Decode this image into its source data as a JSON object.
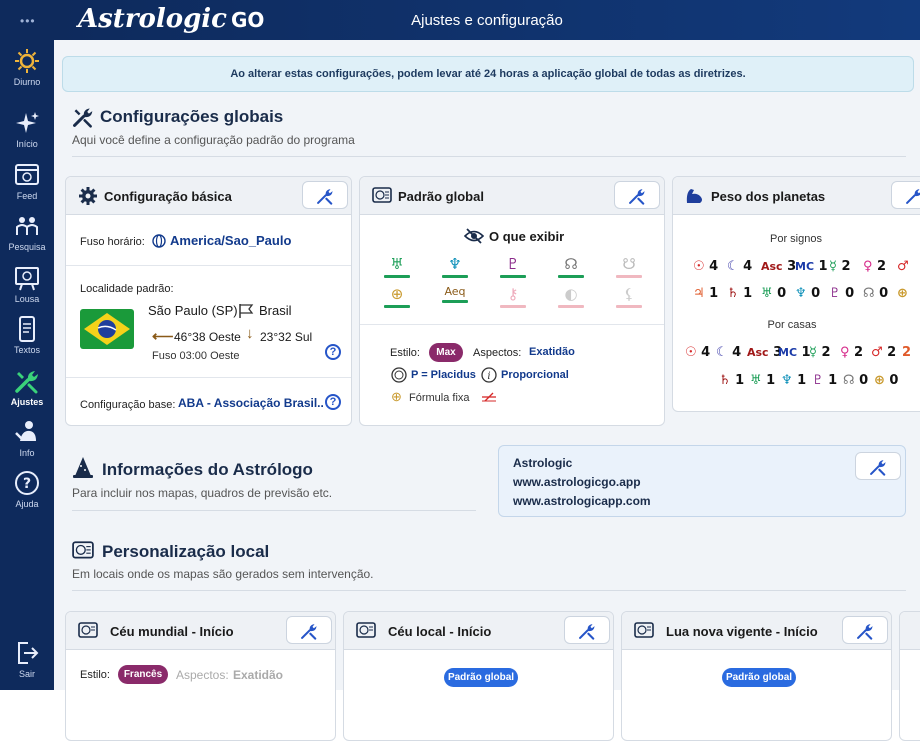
{
  "app": {
    "brand": "Astrologic",
    "brand_suffix": "GO",
    "dots": "•••",
    "page_title": "Ajustes e configuração"
  },
  "sidebar": {
    "items": [
      {
        "label": "Diurno",
        "icon": "sun-icon"
      },
      {
        "label": "Início",
        "icon": "sparkle-icon"
      },
      {
        "label": "Feed",
        "icon": "feed-icon"
      },
      {
        "label": "Pesquisa",
        "icon": "people-icon"
      },
      {
        "label": "Lousa",
        "icon": "board-icon"
      },
      {
        "label": "Textos",
        "icon": "phone-text-icon"
      },
      {
        "label": "Ajustes",
        "icon": "tools-icon",
        "active": true
      },
      {
        "label": "Info",
        "icon": "user-info-icon"
      },
      {
        "label": "Ajuda",
        "icon": "help-icon"
      },
      {
        "label": "Sair",
        "icon": "exit-icon"
      }
    ]
  },
  "banner": "Ao alterar estas configurações, podem levar até 24 horas a aplicação global de todas as diretrizes.",
  "global": {
    "title": "Configurações globais",
    "subtitle": "Aqui você define a configuração padrão do programa"
  },
  "basic": {
    "title": "Configuração básica",
    "tz_label": "Fuso horário:",
    "tz_value": "America/Sao_Paulo",
    "loc_label": "Localidade padrão:",
    "city": "São Paulo (SP)",
    "country": "Brasil",
    "lon": "46°38 Oeste",
    "lat": "23°32 Sul",
    "tz_offset": "Fuso 03:00 Oeste",
    "base_label": "Configuração base:",
    "base_value": "ABA - Associação Brasil..."
  },
  "padrao": {
    "title": "Padrão global",
    "what": "O que exibir",
    "style_label": "Estilo:",
    "style_value": "Max",
    "aspects_label": "Aspectos:",
    "aspects_value": "Exatidão",
    "house_sys": "P = Placidus",
    "proportional": "Proporcional",
    "formula": "Fórmula fixa",
    "row1": [
      {
        "g": "♅",
        "c": "#1c9e57",
        "bar": "#1c9e57"
      },
      {
        "g": "♆",
        "c": "#0b8fb8",
        "bar": "#1c9e57"
      },
      {
        "g": "♇",
        "c": "#8a2a8a",
        "bar": "#1c9e57"
      },
      {
        "g": "☊",
        "c": "#777",
        "bar": "#1c9e57"
      },
      {
        "g": "☋",
        "c": "#bbb",
        "bar": "#f0b8c0"
      }
    ],
    "row2": [
      {
        "g": "⊕",
        "c": "#c99a2e",
        "bar": "#1c9e57"
      },
      {
        "g": "Aeq",
        "c": "#8a5a18",
        "bar": "#1c9e57"
      },
      {
        "g": "⚷",
        "c": "#eeaabb",
        "bar": "#f0b8c0"
      },
      {
        "g": "◐",
        "c": "#ccc",
        "bar": "#f0b8c0"
      },
      {
        "g": "⚸",
        "c": "#ccc",
        "bar": "#f0b8c0"
      }
    ]
  },
  "peso": {
    "title": "Peso dos planetas",
    "by_signs": "Por signos",
    "by_houses": "Por casas",
    "signs1": [
      {
        "g": "☉",
        "v": "4",
        "c": "#d62828"
      },
      {
        "g": "☾",
        "v": "4",
        "c": "#3a3aa8"
      },
      {
        "g": "Asc",
        "v": "3",
        "c": "#a01818"
      },
      {
        "g": "MC",
        "v": "1",
        "c": "#1a3aa8"
      },
      {
        "g": "☿",
        "v": "2",
        "c": "#1c9e57"
      },
      {
        "g": "♀",
        "v": "2",
        "c": "#d62a8a"
      },
      {
        "g": "♂",
        "v": "",
        "c": "#d62828"
      }
    ],
    "signs2": [
      {
        "g": "♃",
        "v": "1",
        "c": "#e05a2a"
      },
      {
        "g": "♄",
        "v": "1",
        "c": "#a01818"
      },
      {
        "g": "♅",
        "v": "0",
        "c": "#1c9e57"
      },
      {
        "g": "♆",
        "v": "0",
        "c": "#0b8fb8"
      },
      {
        "g": "♇",
        "v": "0",
        "c": "#8a2a8a"
      },
      {
        "g": "☊",
        "v": "0",
        "c": "#777"
      },
      {
        "g": "⊕",
        "v": "",
        "c": "#c99a2e"
      }
    ],
    "houses1": [
      {
        "g": "☉",
        "v": "4",
        "c": "#d62828"
      },
      {
        "g": "☾",
        "v": "4",
        "c": "#3a3aa8"
      },
      {
        "g": "Asc",
        "v": "3",
        "c": "#a01818"
      },
      {
        "g": "MC",
        "v": "1",
        "c": "#1a3aa8"
      },
      {
        "g": "☿",
        "v": "2",
        "c": "#1c9e57"
      },
      {
        "g": "♀",
        "v": "2",
        "c": "#d62a8a"
      },
      {
        "g": "♂",
        "v": "2",
        "c": "#d62828"
      },
      {
        "g": "2",
        "v": "",
        "c": "#e05a2a"
      }
    ],
    "houses2": [
      {
        "g": "♄",
        "v": "1",
        "c": "#a01818"
      },
      {
        "g": "♅",
        "v": "1",
        "c": "#1c9e57"
      },
      {
        "g": "♆",
        "v": "1",
        "c": "#0b8fb8"
      },
      {
        "g": "♇",
        "v": "1",
        "c": "#8a2a8a"
      },
      {
        "g": "☊",
        "v": "0",
        "c": "#777"
      },
      {
        "g": "⊕",
        "v": "0",
        "c": "#c99a2e"
      }
    ]
  },
  "astro": {
    "title": "Informações do Astrólogo",
    "subtitle": "Para incluir nos mapas, quadros de previsão etc.",
    "name": "Astrologic",
    "site1": "www.astrologicgo.app",
    "site2": "www.astrologicapp.com"
  },
  "local": {
    "title": "Personalização local",
    "subtitle": "Em locais onde os mapas são gerados sem intervenção."
  },
  "cards": {
    "ceu_mundial": "Céu mundial - Início",
    "style_label": "Estilo:",
    "style_value": "Francês",
    "aspects_label": "Aspectos:",
    "aspects_value": "Exatidão",
    "ceu_local": "Céu local - Início",
    "lua_nova": "Lua nova vigente - Início",
    "padrao_pill": "Padrão global"
  },
  "colors": {
    "navy": "#0e2a5c",
    "accent": "#123a8c",
    "max_pill": "#8a2a6a",
    "active_green": "#3ad27a"
  }
}
